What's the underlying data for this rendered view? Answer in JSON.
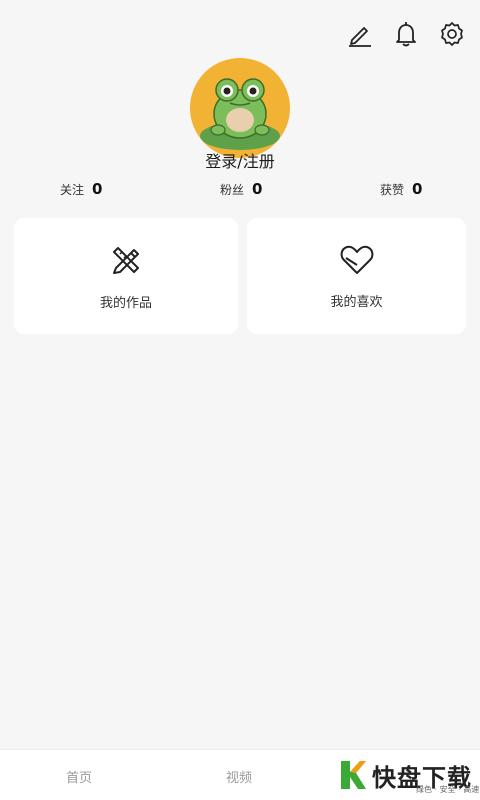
{
  "header": {
    "icons": [
      "edit-icon",
      "bell-icon",
      "gear-icon"
    ]
  },
  "profile": {
    "login_label": "登录/注册"
  },
  "stats": {
    "follow": {
      "label": "关注",
      "value": "0"
    },
    "fans": {
      "label": "粉丝",
      "value": "0"
    },
    "likes": {
      "label": "获赞",
      "value": "0"
    }
  },
  "cards": {
    "works": {
      "label": "我的作品",
      "icon": "pencil-ruler-icon"
    },
    "favorites": {
      "label": "我的喜欢",
      "icon": "heart-icon"
    }
  },
  "tabbar": {
    "home": "首页",
    "video": "视频"
  },
  "watermark": {
    "name": "快盘下载",
    "tagline": "绿色 · 安全 · 高速"
  },
  "colors": {
    "background": "#f6f6f6",
    "avatar_bg": "#f2b233",
    "frog": "#6aa84f",
    "brand_green": "#3aa935",
    "brand_orange": "#f39c12"
  }
}
